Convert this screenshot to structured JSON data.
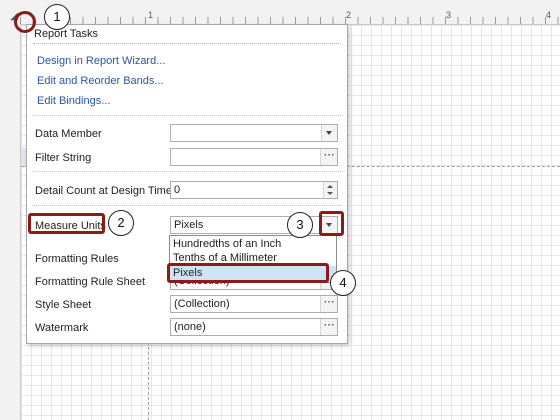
{
  "ruler": {
    "marks": [
      "1",
      "2",
      "3",
      "4"
    ]
  },
  "panel": {
    "title": "Report Tasks",
    "links": [
      "Design in Report Wizard...",
      "Edit and Reorder Bands...",
      "Edit Bindings..."
    ]
  },
  "properties": {
    "data_member": {
      "label": "Data Member",
      "value": ""
    },
    "filter_string": {
      "label": "Filter String",
      "value": ""
    },
    "detail_count": {
      "label": "Detail Count at Design Time",
      "value": "0"
    },
    "measure_units": {
      "label": "Measure Units",
      "value": "Pixels"
    },
    "formatting_rules": {
      "label": "Formatting Rules",
      "value": ""
    },
    "formatting_rule_sheet": {
      "label": "Formatting Rule Sheet",
      "value": "(Collection)"
    },
    "style_sheet": {
      "label": "Style Sheet",
      "value": "(Collection)"
    },
    "watermark": {
      "label": "Watermark",
      "value": "(none)"
    }
  },
  "measure_units_options": [
    "Hundredths of an Inch",
    "Tenths of a Millimeter",
    "Pixels"
  ],
  "measure_units_selected": "Pixels",
  "icons": {
    "dropdown": "chevron-down-icon",
    "ellipsis": "ellipsis-icon",
    "spin": "spin-icon",
    "smart_tag": "smart-tag-icon"
  },
  "callouts": [
    "1",
    "2",
    "3",
    "4"
  ],
  "colors": {
    "highlight": "#8b1a1a",
    "link": "#2a56a6",
    "selection": "#cfe3f7"
  }
}
